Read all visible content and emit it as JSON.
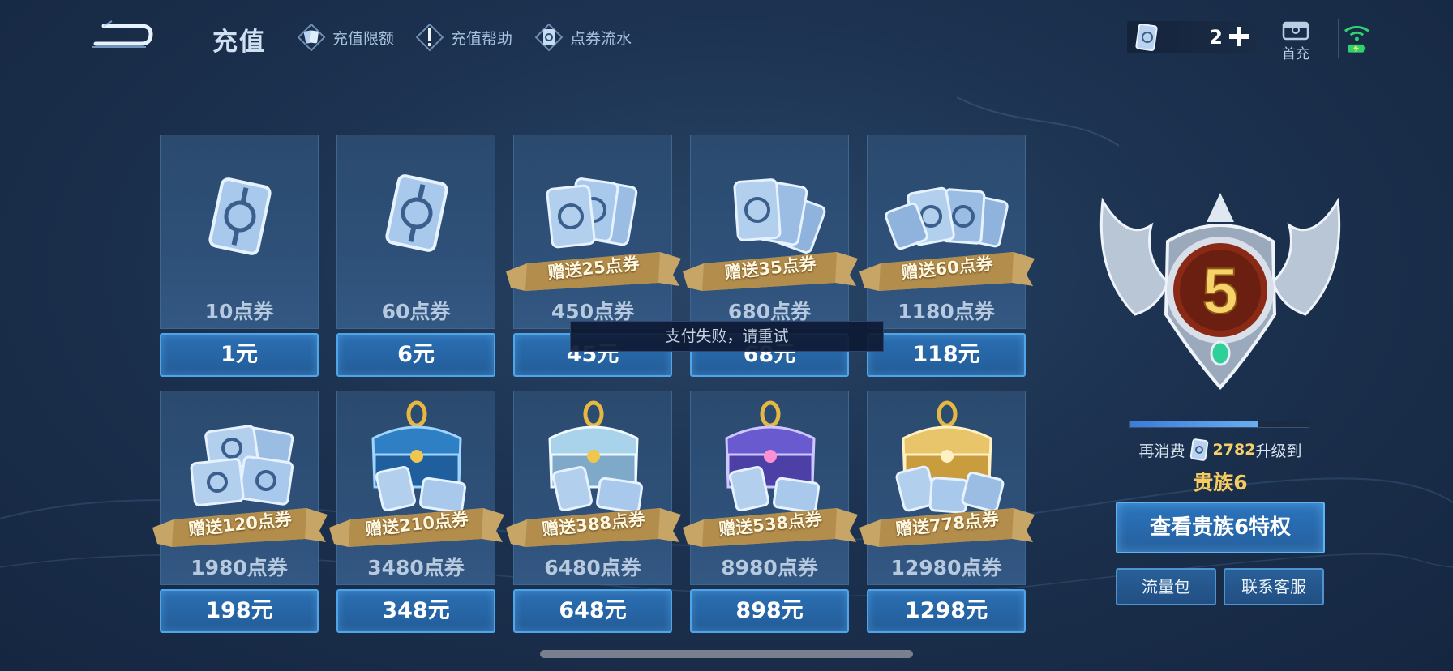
{
  "header": {
    "title": "充值",
    "nav": [
      {
        "label": "充值限额",
        "icon": "card-icon"
      },
      {
        "label": "充值帮助",
        "icon": "exclamation-icon"
      },
      {
        "label": "点券流水",
        "icon": "ticket-icon"
      }
    ],
    "balance": "2",
    "first_charge_label": "首充"
  },
  "packages": [
    {
      "amount": "10点券",
      "price": "1元",
      "bonus": ""
    },
    {
      "amount": "60点券",
      "price": "6元",
      "bonus": ""
    },
    {
      "amount": "450点券",
      "price": "45元",
      "bonus": "赠送25点券"
    },
    {
      "amount": "680点券",
      "price": "68元",
      "bonus": "赠送35点券"
    },
    {
      "amount": "1180点券",
      "price": "118元",
      "bonus": "赠送60点券"
    },
    {
      "amount": "1980点券",
      "price": "198元",
      "bonus": "赠送120点券"
    },
    {
      "amount": "3480点券",
      "price": "348元",
      "bonus": "赠送210点券"
    },
    {
      "amount": "6480点券",
      "price": "648元",
      "bonus": "赠送388点券"
    },
    {
      "amount": "8980点券",
      "price": "898元",
      "bonus": "赠送538点券"
    },
    {
      "amount": "12980点券",
      "price": "1298元",
      "bonus": "赠送778点券"
    }
  ],
  "toast": "支付失败，请重试",
  "noble": {
    "level": "5",
    "progress_fraction": 0.72,
    "upgrade_prefix": "再消费",
    "upgrade_amount": "2782",
    "upgrade_suffix": "升级到",
    "next_level": "贵族6",
    "privilege_button": "查看贵族6特权",
    "data_pack_button": "流量包",
    "support_button": "联系客服"
  },
  "colors": {
    "accent_blue": "#4fa5ea",
    "gold": "#f7cc5f",
    "badge_red": "#8a2a16"
  }
}
